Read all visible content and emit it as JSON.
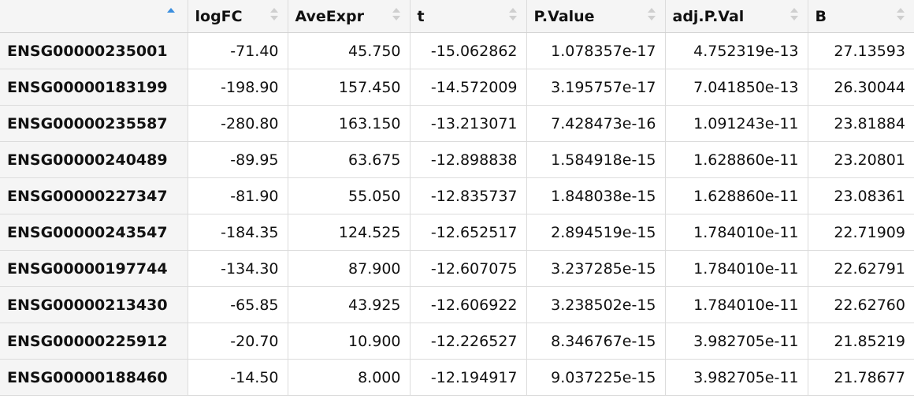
{
  "table": {
    "columns": [
      "",
      "logFC",
      "AveExpr",
      "t",
      "P.Value",
      "adj.P.Val",
      "B"
    ],
    "rows": [
      [
        "ENSG00000235001",
        "-71.40",
        "45.750",
        "-15.062862",
        "1.078357e-17",
        "4.752319e-13",
        "27.13593"
      ],
      [
        "ENSG00000183199",
        "-198.90",
        "157.450",
        "-14.572009",
        "3.195757e-17",
        "7.041850e-13",
        "26.30044"
      ],
      [
        "ENSG00000235587",
        "-280.80",
        "163.150",
        "-13.213071",
        "7.428473e-16",
        "1.091243e-11",
        "23.81884"
      ],
      [
        "ENSG00000240489",
        "-89.95",
        "63.675",
        "-12.898838",
        "1.584918e-15",
        "1.628860e-11",
        "23.20801"
      ],
      [
        "ENSG00000227347",
        "-81.90",
        "55.050",
        "-12.835737",
        "1.848038e-15",
        "1.628860e-11",
        "23.08361"
      ],
      [
        "ENSG00000243547",
        "-184.35",
        "124.525",
        "-12.652517",
        "2.894519e-15",
        "1.784010e-11",
        "22.71909"
      ],
      [
        "ENSG00000197744",
        "-134.30",
        "87.900",
        "-12.607075",
        "3.237285e-15",
        "1.784010e-11",
        "22.62791"
      ],
      [
        "ENSG00000213430",
        "-65.85",
        "43.925",
        "-12.606922",
        "3.238502e-15",
        "1.784010e-11",
        "22.62760"
      ],
      [
        "ENSG00000225912",
        "-20.70",
        "10.900",
        "-12.226527",
        "8.346767e-15",
        "3.982705e-11",
        "21.85219"
      ],
      [
        "ENSG00000188460",
        "-14.50",
        "8.000",
        "-12.194917",
        "9.037225e-15",
        "3.982705e-11",
        "21.78677"
      ]
    ]
  },
  "colors": {
    "header_bg": "#f5f5f5",
    "border": "#dcdcdc",
    "sort_inactive": "#cfcfcf",
    "sort_active": "#3b8ede"
  },
  "icons": {
    "sort_active": "sort-ascending-icon",
    "sort_inactive": "sort-both-icon"
  }
}
